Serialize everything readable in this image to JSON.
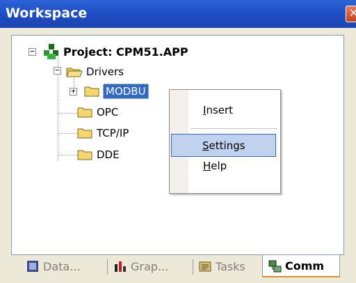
{
  "window": {
    "title": "Workspace",
    "close_glyph": "✕"
  },
  "tree": {
    "root": {
      "label": "Project: CPM51.APP",
      "icon": "project-icon",
      "expander": "−"
    },
    "drivers": {
      "label": "Drivers",
      "expander": "−"
    },
    "modbus": {
      "label": "MODBU",
      "expander": "+"
    },
    "opc": {
      "label": "OPC"
    },
    "tcpip": {
      "label": "TCP/IP"
    },
    "dde": {
      "label": "DDE"
    }
  },
  "context_menu": {
    "items": [
      {
        "label": "Insert",
        "underline": "I"
      },
      {
        "label": "Settings",
        "underline": "S",
        "highlighted": true
      },
      {
        "label": "Help",
        "underline": "H"
      }
    ]
  },
  "tabs": [
    {
      "label": "Data...",
      "icon": "database-icon"
    },
    {
      "label": "Grap...",
      "icon": "graphics-icon"
    },
    {
      "label": "Tasks",
      "icon": "tasks-icon"
    },
    {
      "label": "Comm",
      "icon": "comm-icon",
      "active": true
    }
  ],
  "colors": {
    "titlebar": "#2e64d8",
    "selection": "#316ac5",
    "folder": "#f5d76e",
    "menu_highlight": "#c1d2ee"
  }
}
